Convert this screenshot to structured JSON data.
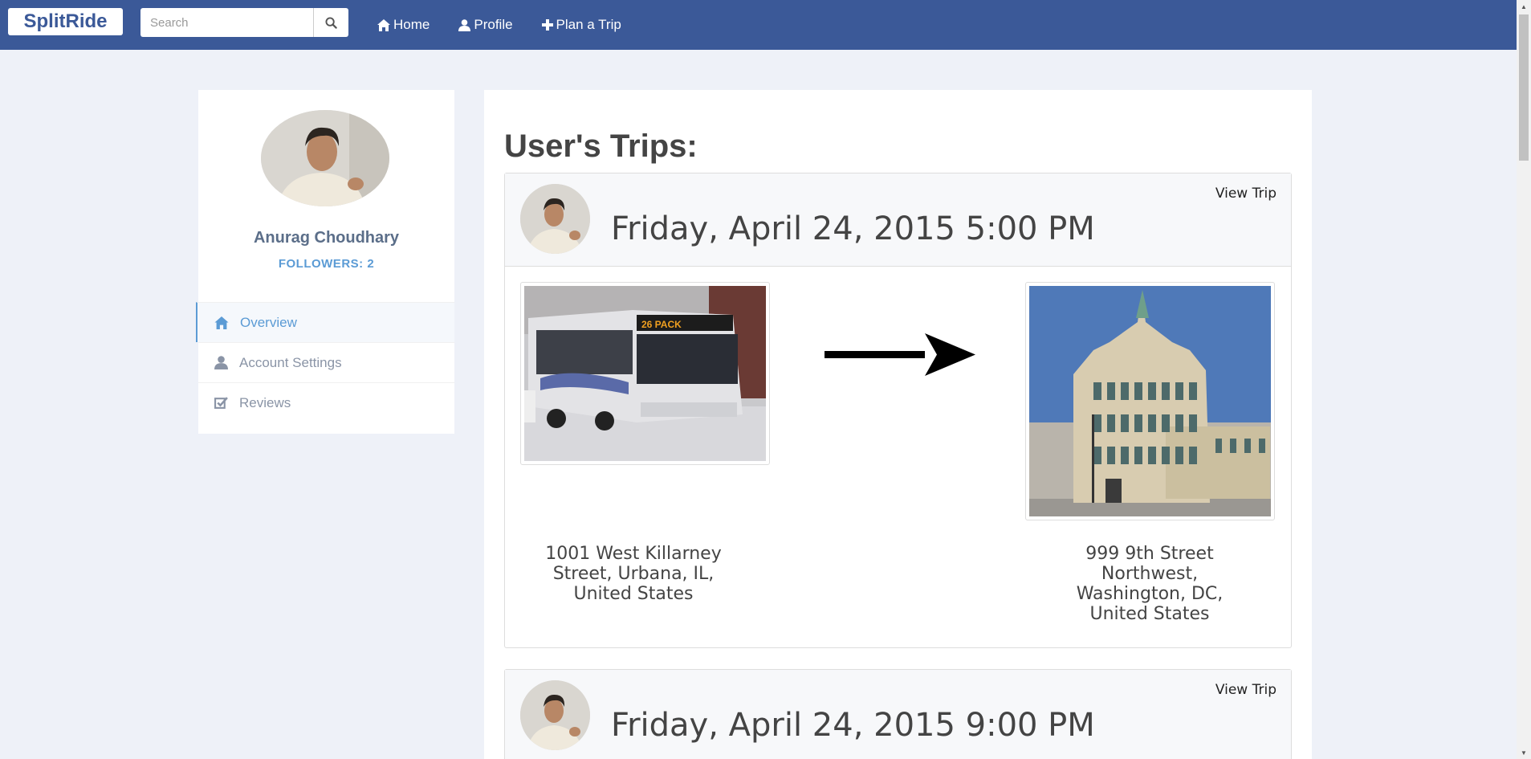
{
  "navbar": {
    "brand": "SplitRide",
    "search_placeholder": "Search",
    "links": [
      {
        "label": "Home",
        "icon": "home-icon"
      },
      {
        "label": "Profile",
        "icon": "user-icon"
      },
      {
        "label": "Plan a Trip",
        "icon": "plus-icon"
      }
    ]
  },
  "profile": {
    "name": "Anurag Choudhary",
    "followers": "FOLLOWERS: 2",
    "menu": [
      {
        "label": "Overview",
        "icon": "home-icon",
        "active": true
      },
      {
        "label": "Account Settings",
        "icon": "user-icon",
        "active": false
      },
      {
        "label": "Reviews",
        "icon": "checkbox-icon",
        "active": false
      }
    ]
  },
  "main": {
    "title": "User's Trips:",
    "trips": [
      {
        "date": "Friday, April 24, 2015 5:00 PM",
        "view_label": "View Trip",
        "origin": "1001 West Killarney Street, Urbana, IL, United States",
        "destination": "999 9th Street Northwest, Washington, DC, United States"
      },
      {
        "date": "Friday, April 24, 2015 9:00 PM",
        "view_label": "View Trip"
      }
    ]
  },
  "colors": {
    "navbar": "#3b5998",
    "page_bg": "#eef1f8",
    "accent": "#5b9bd5"
  }
}
